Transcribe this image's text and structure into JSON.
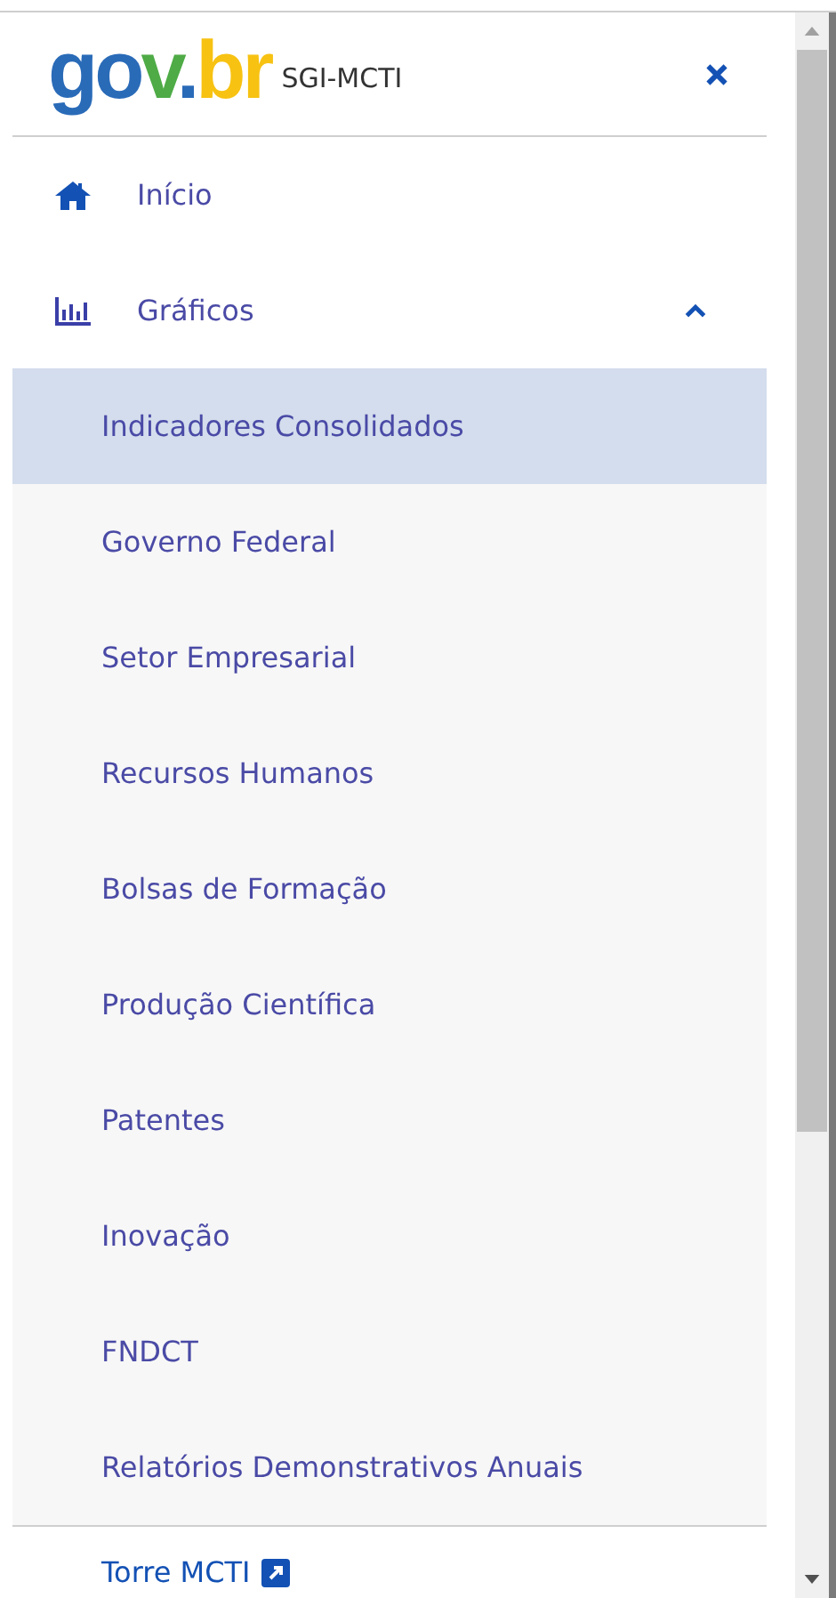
{
  "header": {
    "logo": "gov.br",
    "title": "SGI-MCTI"
  },
  "menu": [
    {
      "kind": "link",
      "label": "Início"
    },
    {
      "kind": "group",
      "label": "Gráficos",
      "expanded": true,
      "children": [
        {
          "label": "Indicadores Consolidados",
          "selected": true
        },
        {
          "label": "Governo Federal",
          "selected": false
        },
        {
          "label": "Setor Empresarial",
          "selected": false
        },
        {
          "label": "Recursos Humanos",
          "selected": false
        },
        {
          "label": "Bolsas de Formação",
          "selected": false
        },
        {
          "label": "Produção Científica",
          "selected": false
        },
        {
          "label": "Patentes",
          "selected": false
        },
        {
          "label": "Inovação",
          "selected": false
        },
        {
          "label": "FNDCT",
          "selected": false
        },
        {
          "label": "Relatórios Demonstrativos Anuais",
          "selected": false
        }
      ]
    }
  ],
  "external_link": {
    "label": "Torre MCTI"
  }
}
